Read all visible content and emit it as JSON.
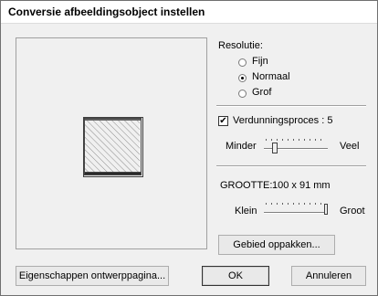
{
  "window": {
    "title": "Conversie afbeeldingsobject instellen"
  },
  "resolution": {
    "label": "Resolutie:",
    "options": [
      "Fijn",
      "Normaal",
      "Grof"
    ],
    "selected": "Normaal"
  },
  "thinning": {
    "checkbox_label": "Verdunningsproces : 5",
    "checked": true,
    "slider_min_label": "Minder",
    "slider_max_label": "Veel",
    "slider_value": 5
  },
  "size": {
    "label": "GROOTTE:",
    "value": "100 x 91 mm",
    "slider_min_label": "Klein",
    "slider_max_label": "Groot"
  },
  "buttons": {
    "pick_area": "Gebied oppakken...",
    "properties": "Eigenschappen ontwerppagina...",
    "ok": "OK",
    "cancel": "Annuleren"
  }
}
